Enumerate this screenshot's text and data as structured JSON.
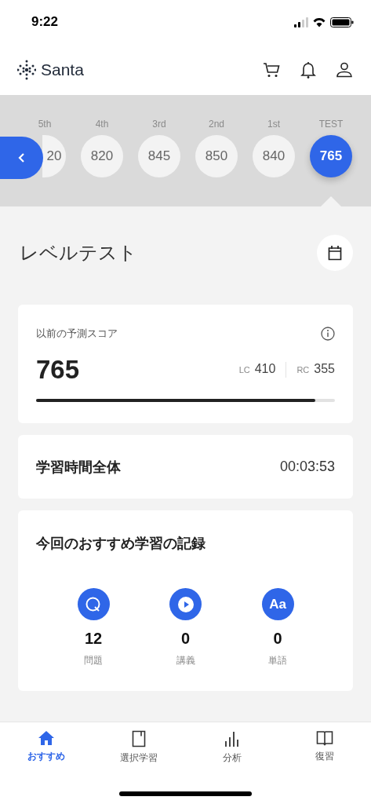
{
  "status_bar": {
    "time": "9:22"
  },
  "header": {
    "logo": "Santa"
  },
  "history": [
    {
      "label": "5th",
      "score": "20",
      "selected": false
    },
    {
      "label": "4th",
      "score": "820",
      "selected": false
    },
    {
      "label": "3rd",
      "score": "845",
      "selected": false
    },
    {
      "label": "2nd",
      "score": "850",
      "selected": false
    },
    {
      "label": "1st",
      "score": "840",
      "selected": false
    },
    {
      "label": "TEST",
      "score": "765",
      "selected": true
    }
  ],
  "page_title": "レベルテスト",
  "score_card": {
    "label": "以前の予測スコア",
    "score": "765",
    "lc_label": "LC",
    "lc": "410",
    "rc_label": "RC",
    "rc": "355",
    "level": 0.934
  },
  "time_card": {
    "label": "学習時間全体",
    "value": "00:03:53"
  },
  "record_card": {
    "title": "今回のおすすめ学習の記録",
    "stats": [
      {
        "kind": "question",
        "count": "12",
        "label": "問題"
      },
      {
        "kind": "lecture",
        "count": "0",
        "label": "講義"
      },
      {
        "kind": "word",
        "count": "0",
        "label": "単語",
        "icon_text": "Aa"
      }
    ]
  },
  "tab_bar": [
    {
      "kind": "home",
      "label": "おすすめ",
      "selected": true
    },
    {
      "kind": "book",
      "label": "選択学習",
      "selected": false
    },
    {
      "kind": "chart",
      "label": "分析",
      "selected": false
    },
    {
      "kind": "open-book",
      "label": "復習",
      "selected": false
    }
  ]
}
